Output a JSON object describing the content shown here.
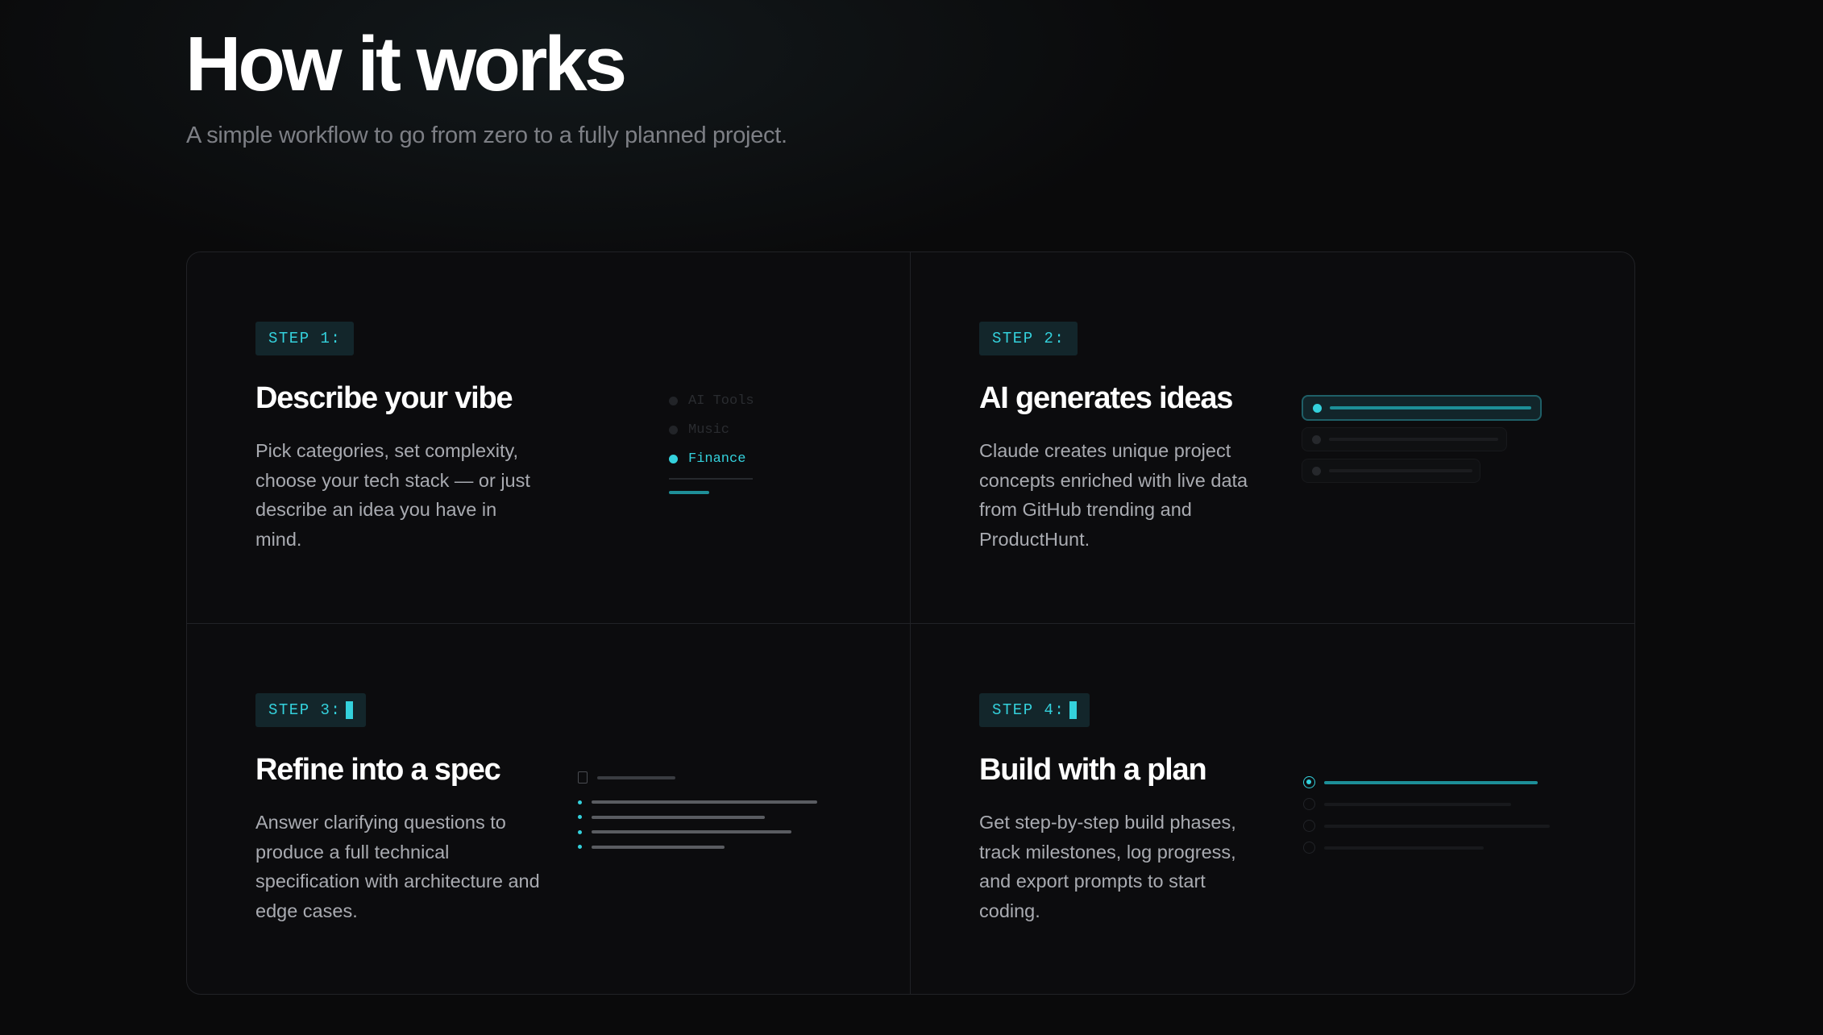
{
  "header": {
    "title": "How it works",
    "subtitle": "A simple workflow to go from zero to a fully planned project."
  },
  "steps": [
    {
      "badge": "STEP 1:",
      "title": "Describe your vibe",
      "description": "Pick categories, set complexity, choose your tech stack — or just describe an idea you have in mind.",
      "categories": [
        {
          "label": "AI Tools",
          "state": "dim"
        },
        {
          "label": "Music",
          "state": "dim"
        },
        {
          "label": "Finance",
          "state": "active"
        }
      ]
    },
    {
      "badge": "STEP 2:",
      "title": "AI generates ideas",
      "description": "Claude creates unique project concepts enriched with live data from GitHub trending and ProductHunt."
    },
    {
      "badge": "STEP 3:",
      "title": "Refine into a spec",
      "description": "Answer clarifying questions to produce a full technical specification with architecture and edge cases."
    },
    {
      "badge": "STEP 4:",
      "title": "Build with a plan",
      "description": "Get step-by-step build phases, track milestones, log progress, and export prompts to start coding."
    }
  ],
  "colors": {
    "accent": "#34d1dc",
    "background": "#0a0a0b",
    "card_border": "#212226",
    "muted_text": "#a9abb1"
  }
}
